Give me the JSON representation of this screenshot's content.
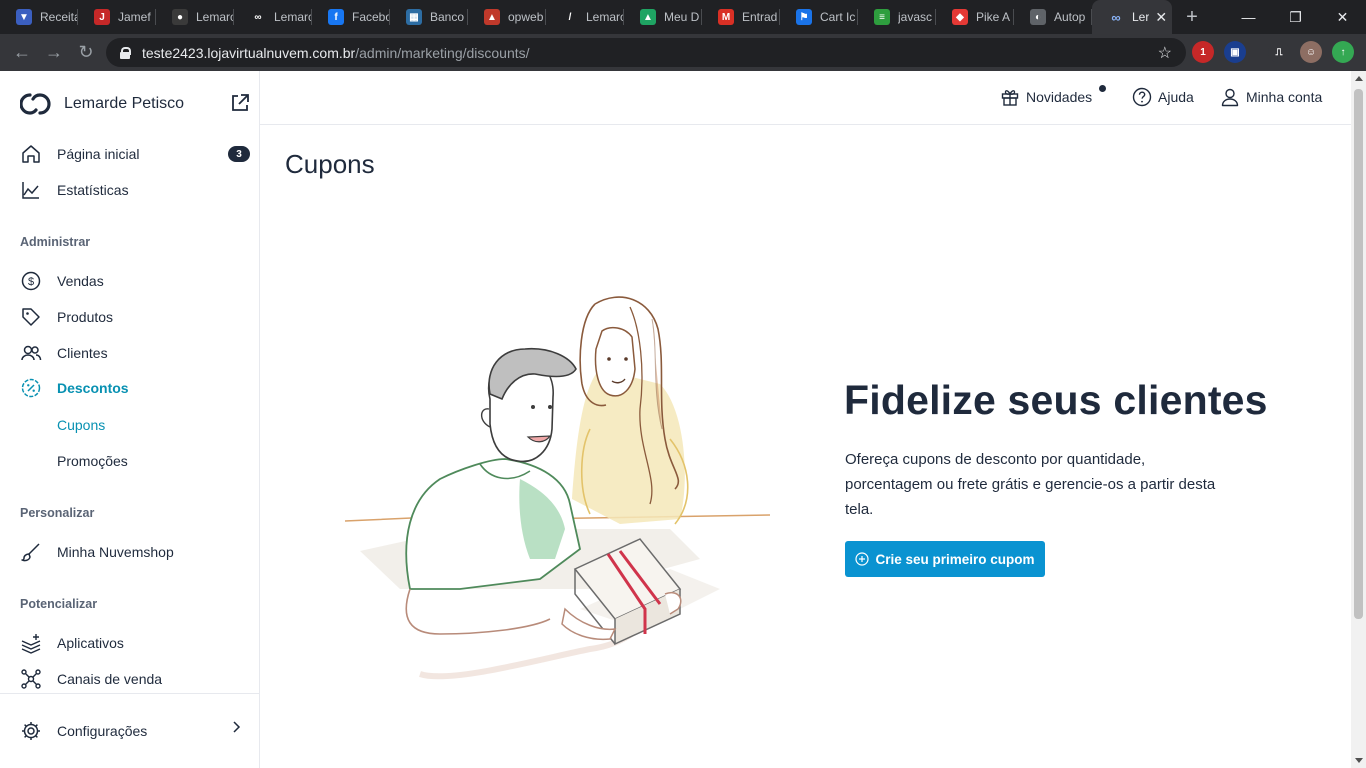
{
  "browser": {
    "tabs": [
      {
        "title": "Receita",
        "fav_color": "#3b5fc0",
        "fav_glyph": "▼"
      },
      {
        "title": "Jamef",
        "fav_color": "#c62828",
        "fav_glyph": "J"
      },
      {
        "title": "Lemarc",
        "fav_color": "#3a3a3a",
        "fav_glyph": "●"
      },
      {
        "title": "Lemarc",
        "fav_color": "#202124",
        "fav_glyph": "∞"
      },
      {
        "title": "Facebo",
        "fav_color": "#1877f2",
        "fav_glyph": "f"
      },
      {
        "title": "Banco",
        "fav_color": "#2d6da3",
        "fav_glyph": "▦"
      },
      {
        "title": "opweb",
        "fav_color": "#c0392b",
        "fav_glyph": "▲"
      },
      {
        "title": "Lemarc",
        "fav_color": "#202124",
        "fav_glyph": "/"
      },
      {
        "title": "Meu D",
        "fav_color": "#1fa463",
        "fav_glyph": "▲"
      },
      {
        "title": "Entrad",
        "fav_color": "#d93025",
        "fav_glyph": "M"
      },
      {
        "title": "Cart Ic",
        "fav_color": "#1a73e8",
        "fav_glyph": "⚑"
      },
      {
        "title": "javasc",
        "fav_color": "#2e9e3e",
        "fav_glyph": "≡"
      },
      {
        "title": "Pike A",
        "fav_color": "#e53935",
        "fav_glyph": "◆"
      },
      {
        "title": "Autop",
        "fav_color": "#5f6368",
        "fav_glyph": "◐"
      }
    ],
    "active_tab": {
      "title": "Ler",
      "fav_glyph": "∞",
      "close": "✕"
    },
    "new_tab": "+",
    "window_controls": {
      "minimize": "—",
      "restore": "❐",
      "close": "✕"
    },
    "nav": {
      "back": "←",
      "forward": "→",
      "reload": "↻"
    },
    "url_host": "teste2423.lojavirtualnuvem.com.br",
    "url_path": "/admin/marketing/discounts/",
    "star": "☆",
    "extensions": [
      {
        "name": "extension-red",
        "color": "#c62828",
        "glyph": "1"
      },
      {
        "name": "extension-blue",
        "color": "#1a3e8f",
        "glyph": "▣"
      },
      {
        "name": "cast",
        "color": "#35363a",
        "glyph": "⎍"
      },
      {
        "name": "profile",
        "color": "#8d6e63",
        "glyph": "☺"
      },
      {
        "name": "update",
        "color": "#34a853",
        "glyph": "↑"
      }
    ]
  },
  "sidebar": {
    "store_name": "Lemarde Petisco",
    "items_top": [
      {
        "label": "Página inicial",
        "icon": "home-icon",
        "badge": "3"
      },
      {
        "label": "Estatísticas",
        "icon": "chart-icon"
      }
    ],
    "section_admin": "Administrar",
    "items_admin": [
      {
        "label": "Vendas",
        "icon": "dollar-icon"
      },
      {
        "label": "Produtos",
        "icon": "tag-icon"
      },
      {
        "label": "Clientes",
        "icon": "users-icon"
      },
      {
        "label": "Descontos",
        "icon": "discount-icon",
        "active": true
      }
    ],
    "sub_items": [
      {
        "label": "Cupons",
        "active": true
      },
      {
        "label": "Promoções"
      }
    ],
    "section_personalize": "Personalizar",
    "items_personalize": [
      {
        "label": "Minha Nuvemshop",
        "icon": "brush-icon"
      }
    ],
    "section_boost": "Potencializar",
    "items_boost": [
      {
        "label": "Aplicativos",
        "icon": "apps-icon"
      },
      {
        "label": "Canais de venda",
        "icon": "channels-icon"
      }
    ],
    "settings": {
      "label": "Configurações",
      "icon": "gear-icon"
    }
  },
  "topbar": {
    "news": "Novidades",
    "help": "Ajuda",
    "account": "Minha conta"
  },
  "main": {
    "page_title": "Cupons",
    "hero_title": "Fidelize seus clientes",
    "hero_text": "Ofereça cupons de desconto por quantidade, porcentagem ou frete grátis e gerencie-os a partir desta tela.",
    "cta_label": "Crie seu primeiro cupom"
  },
  "colors": {
    "accent": "#0891b2",
    "button": "#0a93d1",
    "text": "#1f2a3c"
  }
}
